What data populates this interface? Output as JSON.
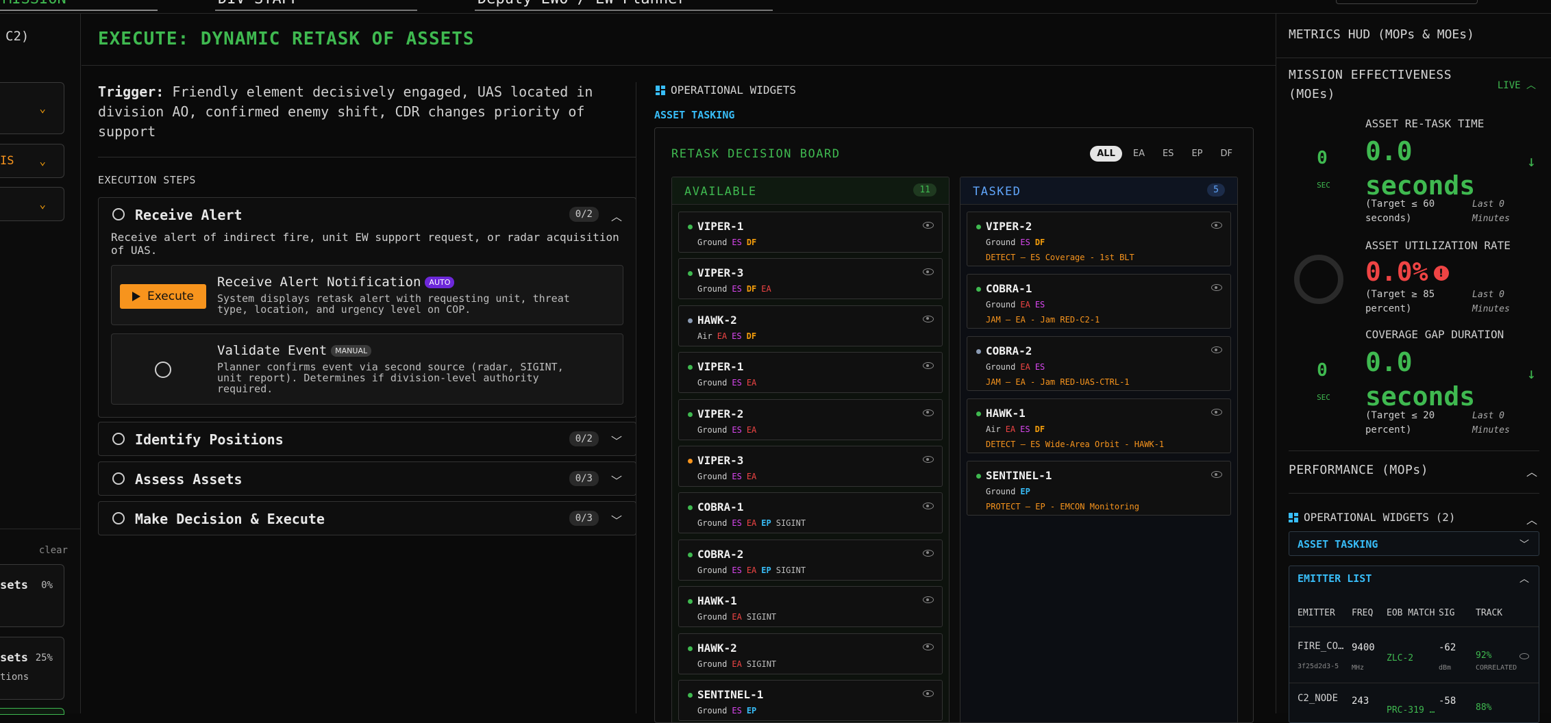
{
  "topbar": {
    "field1": "MISSION",
    "field2": "DIV STAFF",
    "field3": "Deputy EWO / EW Planner"
  },
  "leftbar": {
    "title": "C2)",
    "box2_text": "IS",
    "clear": "clear",
    "card1_name": "sets",
    "card1_pct": "0%",
    "card2_name": "sets",
    "card2_pct": "25%",
    "card2_sub": "tions"
  },
  "main": {
    "title": "EXECUTE: DYNAMIC RETASK OF ASSETS",
    "trigger_label": "Trigger:",
    "trigger_text": "Friendly element decisively engaged, UAS located in division AO, confirmed enemy shift, CDR changes priority of support",
    "exec_steps_label": "EXECUTION STEPS",
    "steps": [
      {
        "title": "Receive Alert",
        "count": "0/2",
        "desc": "Receive alert of indirect fire, unit EW support request, or radar acquisition of UAS.",
        "tasks": [
          {
            "title": "Receive Alert Notification",
            "badge": "AUTO",
            "button": "Execute",
            "desc": "System displays retask alert with requesting unit, threat type, location, and urgency level on COP."
          },
          {
            "title": "Validate Event",
            "badge": "MANUAL",
            "desc": "Planner confirms event via second source (radar, SIGINT, unit report). Determines if division-level authority required."
          }
        ]
      },
      {
        "title": "Identify Positions",
        "count": "0/2"
      },
      {
        "title": "Assess Assets",
        "count": "0/3"
      },
      {
        "title": "Make Decision & Execute",
        "count": "0/3"
      }
    ]
  },
  "widgets": {
    "label": "OPERATIONAL WIDGETS",
    "section": "ASSET TASKING",
    "board_title": "RETASK DECISION BOARD",
    "filters": [
      "ALL",
      "EA",
      "ES",
      "EP",
      "DF"
    ],
    "available": {
      "title": "AVAILABLE",
      "count": "11",
      "cards": [
        {
          "name": "VIPER-1",
          "domain": "Ground",
          "tags": [
            "ES",
            "DF"
          ],
          "status": "#3fb950"
        },
        {
          "name": "VIPER-3",
          "domain": "Ground",
          "tags": [
            "ES",
            "DF",
            "EA"
          ],
          "status": "#3fb950"
        },
        {
          "name": "HAWK-2",
          "domain": "Air",
          "tags": [
            "EA",
            "ES",
            "DF"
          ],
          "status": "#8b9bb4"
        },
        {
          "name": "VIPER-1",
          "domain": "Ground",
          "tags": [
            "ES",
            "EA"
          ],
          "status": "#3fb950"
        },
        {
          "name": "VIPER-2",
          "domain": "Ground",
          "tags": [
            "ES",
            "EA"
          ],
          "status": "#3fb950"
        },
        {
          "name": "VIPER-3",
          "domain": "Ground",
          "tags": [
            "ES",
            "EA"
          ],
          "status": "#f7941d"
        },
        {
          "name": "COBRA-1",
          "domain": "Ground",
          "tags": [
            "ES",
            "EA",
            "EP",
            "SIGINT"
          ],
          "status": "#3fb950"
        },
        {
          "name": "COBRA-2",
          "domain": "Ground",
          "tags": [
            "ES",
            "EA",
            "EP",
            "SIGINT"
          ],
          "status": "#3fb950"
        },
        {
          "name": "HAWK-1",
          "domain": "Ground",
          "tags": [
            "EA",
            "SIGINT"
          ],
          "status": "#3fb950"
        },
        {
          "name": "HAWK-2",
          "domain": "Ground",
          "tags": [
            "EA",
            "SIGINT"
          ],
          "status": "#3fb950"
        },
        {
          "name": "SENTINEL-1",
          "domain": "Ground",
          "tags": [
            "ES",
            "EP"
          ],
          "status": "#3fb950"
        }
      ]
    },
    "tasked": {
      "title": "TASKED",
      "count": "5",
      "cards": [
        {
          "name": "VIPER-2",
          "domain": "Ground",
          "tags": [
            "ES",
            "DF"
          ],
          "mission": "DETECT — ES Coverage - 1st BLT",
          "status": "#3fb950"
        },
        {
          "name": "COBRA-1",
          "domain": "Ground",
          "tags": [
            "EA",
            "ES"
          ],
          "mission": "JAM — EA - Jam RED-C2-1",
          "status": "#3fb950"
        },
        {
          "name": "COBRA-2",
          "domain": "Ground",
          "tags": [
            "EA",
            "ES"
          ],
          "mission": "JAM — EA - Jam RED-UAS-CTRL-1",
          "status": "#8b9bb4"
        },
        {
          "name": "HAWK-1",
          "domain": "Air",
          "tags": [
            "EA",
            "ES",
            "DF"
          ],
          "mission": "DETECT — ES Wide-Area Orbit - HAWK-1",
          "status": "#3fb950"
        },
        {
          "name": "SENTINEL-1",
          "domain": "Ground",
          "tags": [
            "EP"
          ],
          "mission": "PROTECT — EP - EMCON Monitoring",
          "status": "#3fb950"
        }
      ]
    }
  },
  "hud": {
    "title": "METRICS HUD (MOPs & MOEs)",
    "moe_title": "MISSION EFFECTIVENESS (MOEs)",
    "live": "LIVE",
    "metrics": [
      {
        "gauge": "0",
        "unit": "SEC",
        "label": "ASSET RE-TASK TIME",
        "value": "0.0 seconds",
        "target": "(Target ≤ 60 seconds)",
        "last": "Last 0 Minutes"
      },
      {
        "label": "ASSET UTILIZATION RATE",
        "value": "0.0%",
        "target": "(Target ≥ 85 percent)",
        "last": "Last 0 Minutes"
      },
      {
        "gauge": "0",
        "unit": "SEC",
        "label": "COVERAGE GAP DURATION",
        "value": "0.0 seconds",
        "target": "(Target ≤ 20 percent)",
        "last": "Last 0 Minutes"
      }
    ],
    "perf_title": "PERFORMANCE (MOPs)",
    "ow_title": "OPERATIONAL WIDGETS (2)",
    "acc1": "ASSET TASKING",
    "acc2": "EMITTER LIST",
    "emitter_headers": [
      "EMITTER",
      "FREQ",
      "EOB MATCH",
      "SIG",
      "TRACK"
    ],
    "emitters": [
      {
        "name": "FIRE_CO…",
        "id": "3f25d2d3-5",
        "freq": "9400",
        "freq_unit": "MHz",
        "eob": "ZLC-2",
        "sig": "-62",
        "sig_unit": "dBm",
        "track": "92%",
        "track_status": "CORRELATED"
      },
      {
        "name": "C2_NODE",
        "id": "",
        "freq": "243",
        "freq_unit": "",
        "eob": "PRC-319 …",
        "sig": "-58",
        "sig_unit": "",
        "track": "88%",
        "track_status": ""
      }
    ]
  },
  "colors": {
    "green": "#3fb950",
    "orange": "#f7941d",
    "blue": "#60a5fa",
    "cyan": "#38bdf8",
    "red": "#ef4444"
  }
}
